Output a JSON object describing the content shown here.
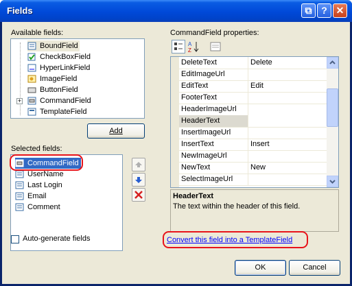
{
  "window": {
    "title": "Fields"
  },
  "titlebar_buttons": {
    "restore": "⧉",
    "help": "?",
    "close": "✕"
  },
  "available": {
    "label": "Available fields:",
    "items": [
      "BoundField",
      "CheckBoxField",
      "HyperLinkField",
      "ImageField",
      "ButtonField",
      "CommandField",
      "TemplateField"
    ],
    "expander": "+"
  },
  "add_button": "Add",
  "selected": {
    "label": "Selected fields:",
    "items": [
      "CommandField",
      "UserName",
      "Last Login",
      "Email",
      "Comment"
    ]
  },
  "autogen": {
    "label": "Auto-generate fields",
    "checked": false
  },
  "properties": {
    "label": "CommandField properties:",
    "rows": [
      {
        "name": "DeleteText",
        "value": "Delete"
      },
      {
        "name": "EditImageUrl",
        "value": ""
      },
      {
        "name": "EditText",
        "value": "Edit"
      },
      {
        "name": "FooterText",
        "value": ""
      },
      {
        "name": "HeaderImageUrl",
        "value": ""
      },
      {
        "name": "HeaderText",
        "value": ""
      },
      {
        "name": "InsertImageUrl",
        "value": ""
      },
      {
        "name": "InsertText",
        "value": "Insert"
      },
      {
        "name": "NewImageUrl",
        "value": ""
      },
      {
        "name": "NewText",
        "value": "New"
      },
      {
        "name": "SelectImageUrl",
        "value": ""
      }
    ],
    "selected_row": "HeaderText"
  },
  "description": {
    "title": "HeaderText",
    "text": "The text within the header of this field."
  },
  "convert_link": "Convert this field into a TemplateField",
  "ok_button": "OK",
  "cancel_button": "Cancel",
  "colors": {
    "highlight": "#316ac5",
    "annotation": "#e8131a",
    "link": "#0000ff",
    "titlebar": "#0049d8"
  }
}
